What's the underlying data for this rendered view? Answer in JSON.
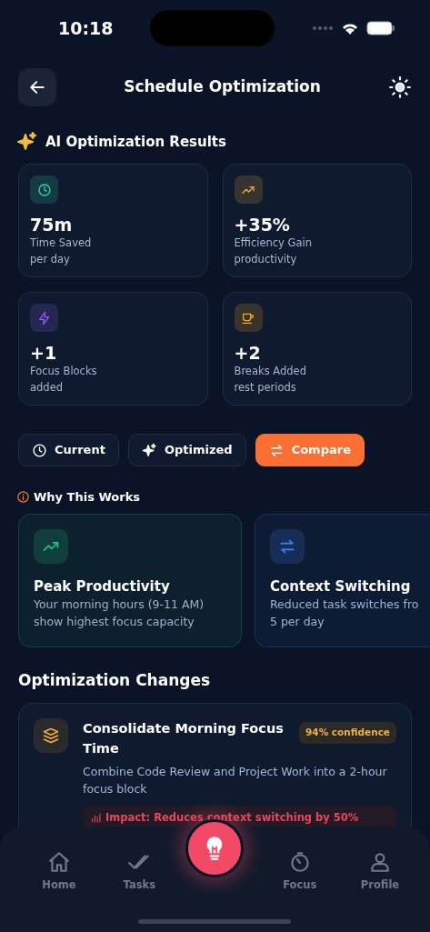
{
  "status_bar": {
    "time": "10:18"
  },
  "header": {
    "title": "Schedule Optimization"
  },
  "results": {
    "title": "AI Optimization Results",
    "stats": [
      {
        "kind": "clock",
        "color": "#2dd4a7",
        "value": "75m",
        "label": "Time Saved",
        "sub": "per day"
      },
      {
        "kind": "trend",
        "color": "#f0a640",
        "value": "+35%",
        "label": "Efficiency Gain",
        "sub": "productivity"
      },
      {
        "kind": "bolt",
        "color": "#8b5cf6",
        "value": "+1",
        "label": "Focus Blocks",
        "sub": "added"
      },
      {
        "kind": "cup",
        "color": "#f5a623",
        "value": "+2",
        "label": "Breaks Added",
        "sub": "rest periods"
      }
    ]
  },
  "views": [
    {
      "kind": "clock",
      "label": "Current",
      "selected": false
    },
    {
      "kind": "sparkle",
      "label": "Optimized",
      "selected": false
    },
    {
      "kind": "swap",
      "label": "Compare",
      "selected": true
    }
  ],
  "why": {
    "title": "Why This Works",
    "cards": [
      {
        "kind": "trend",
        "color": "#22c58b",
        "title": "Peak Productivity",
        "lines": [
          "Your morning hours (9-11 AM)",
          "show highest focus capacity"
        ]
      },
      {
        "kind": "swap",
        "color": "#3b82f6",
        "title": "Context Switching",
        "lines": [
          "Reduced task switches fro",
          "5 per day"
        ]
      }
    ]
  },
  "changes": {
    "title": "Optimization Changes",
    "items": [
      {
        "title": "Consolidate Morning Focus Time",
        "confidence": "94% confidence",
        "description": "Combine Code Review and Project Work into a 2-hour focus block",
        "impact": "Impact: Reduces context switching by 50%"
      }
    ]
  },
  "nav": {
    "items": [
      {
        "kind": "home",
        "label": "Home"
      },
      {
        "kind": "tasks",
        "label": "Tasks"
      },
      {
        "kind": "fab"
      },
      {
        "kind": "focus",
        "label": "Focus"
      },
      {
        "kind": "profile",
        "label": "Profile"
      }
    ]
  }
}
